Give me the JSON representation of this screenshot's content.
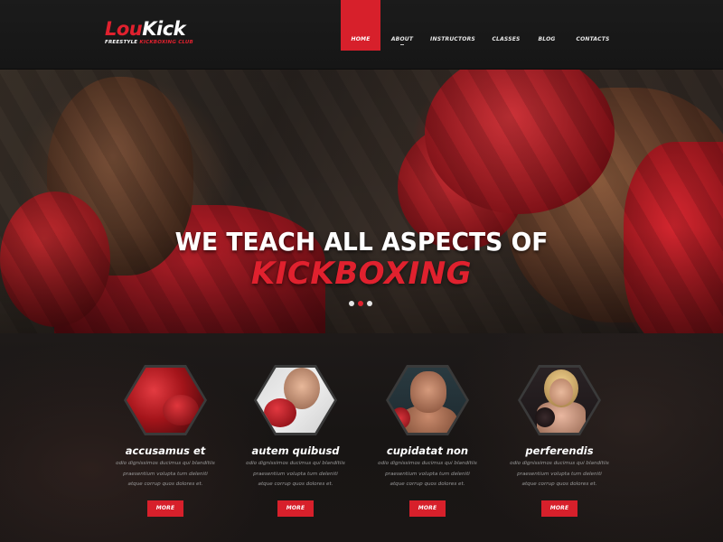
{
  "logo": {
    "name_red": "Lou",
    "name_white": "Kick",
    "tagline_pre": "FREESTYLE ",
    "tagline_highlight": "KICKBOXING CLUB"
  },
  "nav": {
    "items": [
      {
        "label": "HOME",
        "active": true
      },
      {
        "label": "ABOUT"
      },
      {
        "label": "INSTRUCTORS"
      },
      {
        "label": "CLASSES"
      },
      {
        "label": "BLOG"
      },
      {
        "label": "CONTACTS"
      }
    ]
  },
  "hero": {
    "line1": "WE TEACH ALL ASPECTS OF",
    "line2": "KICKBOXING",
    "slides": 3,
    "active_slide": 2
  },
  "features": [
    {
      "title": "accusamus et",
      "lines": [
        "odio dignissimos ducimus qui blanditiis",
        "praesentium volupta tum deleniti",
        "atque corrup quos dolores et."
      ],
      "button": "MORE"
    },
    {
      "title": "autem quibusd",
      "lines": [
        "odio dignissimos ducimus qui blanditiis",
        "praesentium volupta tum deleniti",
        "atque corrup quos dolores et."
      ],
      "button": "MORE"
    },
    {
      "title": "cupidatat non",
      "lines": [
        "odio dignissimos ducimus qui blanditiis",
        "praesentium volupta tum deleniti",
        "atque corrup quos dolores et."
      ],
      "button": "MORE"
    },
    {
      "title": "perferendis",
      "lines": [
        "odio dignissimos ducimus qui blanditiis",
        "praesentium volupta tum deleniti",
        "atque corrup quos dolores et."
      ],
      "button": "MORE"
    }
  ],
  "colors": {
    "accent": "#d7202b",
    "background": "#141414"
  }
}
